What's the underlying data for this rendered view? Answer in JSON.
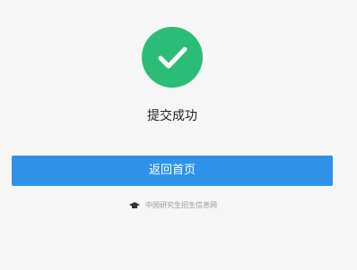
{
  "status": {
    "icon": "checkmark-icon",
    "icon_color": "#2bbd78",
    "title": "提交成功"
  },
  "actions": {
    "return_home_label": "返回首页",
    "button_color": "#2e93e8"
  },
  "footer": {
    "logo_icon": "graduation-cap-icon",
    "site_name": "中国研究生招生信息网"
  }
}
